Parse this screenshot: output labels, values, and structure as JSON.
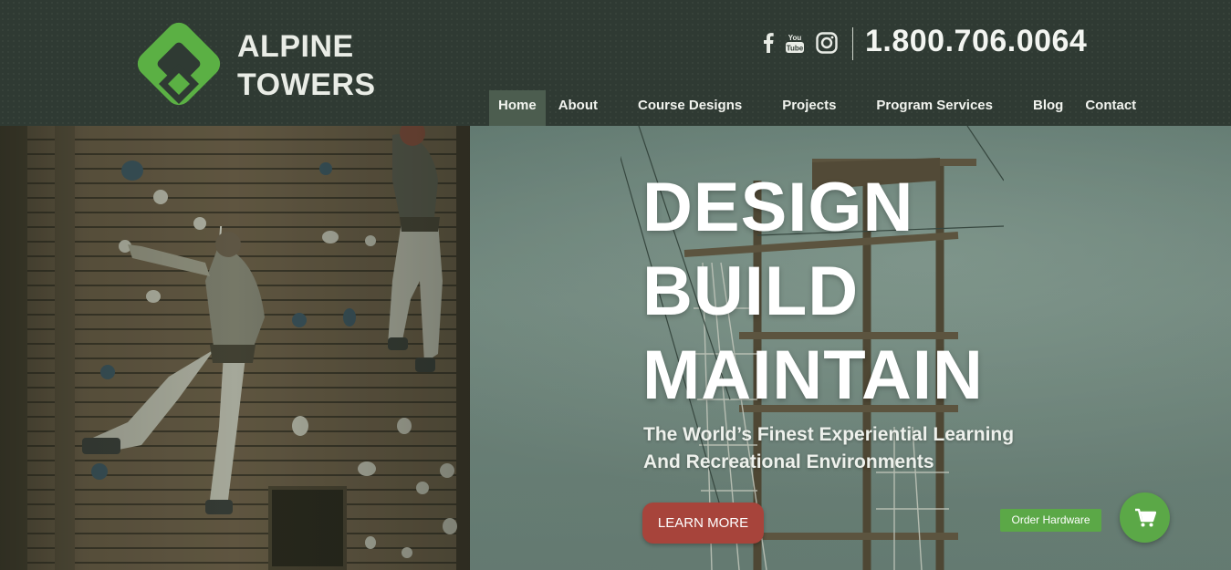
{
  "brand": {
    "name_line1": "ALPINE",
    "name_line2": "TOWERS",
    "logo_color": "#5bb044"
  },
  "header": {
    "phone": "1.800.706.0064",
    "social": [
      {
        "name": "facebook-icon",
        "glyph": "f"
      },
      {
        "name": "youtube-icon",
        "glyph": "You Tube"
      },
      {
        "name": "instagram-icon",
        "glyph": ""
      }
    ]
  },
  "nav": {
    "items": [
      {
        "label": "Home",
        "active": true
      },
      {
        "label": "About"
      },
      {
        "label": "Course Designs"
      },
      {
        "label": "Projects"
      },
      {
        "label": "Program Services"
      },
      {
        "label": "Blog"
      },
      {
        "label": "Contact"
      }
    ]
  },
  "hero": {
    "headline": [
      "DESIGN",
      "BUILD",
      "MAINTAIN"
    ],
    "subtitle_line1": "The World’s Finest Experiential Learning",
    "subtitle_line2": "And Recreational Environments",
    "cta_label": "LEARN MORE",
    "cta_color": "#a7443b"
  },
  "widgets": {
    "order_label": "Order Hardware",
    "accent_color": "#5ba847",
    "cart_icon": "shopping-cart-icon"
  }
}
